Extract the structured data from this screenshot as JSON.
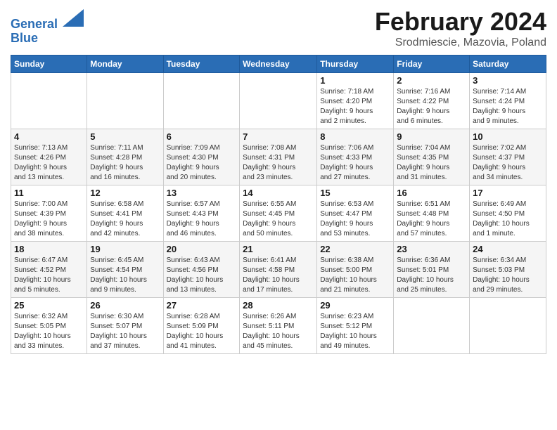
{
  "header": {
    "logo_line1": "General",
    "logo_line2": "Blue",
    "title": "February 2024",
    "subtitle": "Srodmiescie, Mazovia, Poland"
  },
  "days_of_week": [
    "Sunday",
    "Monday",
    "Tuesday",
    "Wednesday",
    "Thursday",
    "Friday",
    "Saturday"
  ],
  "weeks": [
    [
      {
        "day": "",
        "info": ""
      },
      {
        "day": "",
        "info": ""
      },
      {
        "day": "",
        "info": ""
      },
      {
        "day": "",
        "info": ""
      },
      {
        "day": "1",
        "info": "Sunrise: 7:18 AM\nSunset: 4:20 PM\nDaylight: 9 hours\nand 2 minutes."
      },
      {
        "day": "2",
        "info": "Sunrise: 7:16 AM\nSunset: 4:22 PM\nDaylight: 9 hours\nand 6 minutes."
      },
      {
        "day": "3",
        "info": "Sunrise: 7:14 AM\nSunset: 4:24 PM\nDaylight: 9 hours\nand 9 minutes."
      }
    ],
    [
      {
        "day": "4",
        "info": "Sunrise: 7:13 AM\nSunset: 4:26 PM\nDaylight: 9 hours\nand 13 minutes."
      },
      {
        "day": "5",
        "info": "Sunrise: 7:11 AM\nSunset: 4:28 PM\nDaylight: 9 hours\nand 16 minutes."
      },
      {
        "day": "6",
        "info": "Sunrise: 7:09 AM\nSunset: 4:30 PM\nDaylight: 9 hours\nand 20 minutes."
      },
      {
        "day": "7",
        "info": "Sunrise: 7:08 AM\nSunset: 4:31 PM\nDaylight: 9 hours\nand 23 minutes."
      },
      {
        "day": "8",
        "info": "Sunrise: 7:06 AM\nSunset: 4:33 PM\nDaylight: 9 hours\nand 27 minutes."
      },
      {
        "day": "9",
        "info": "Sunrise: 7:04 AM\nSunset: 4:35 PM\nDaylight: 9 hours\nand 31 minutes."
      },
      {
        "day": "10",
        "info": "Sunrise: 7:02 AM\nSunset: 4:37 PM\nDaylight: 9 hours\nand 34 minutes."
      }
    ],
    [
      {
        "day": "11",
        "info": "Sunrise: 7:00 AM\nSunset: 4:39 PM\nDaylight: 9 hours\nand 38 minutes."
      },
      {
        "day": "12",
        "info": "Sunrise: 6:58 AM\nSunset: 4:41 PM\nDaylight: 9 hours\nand 42 minutes."
      },
      {
        "day": "13",
        "info": "Sunrise: 6:57 AM\nSunset: 4:43 PM\nDaylight: 9 hours\nand 46 minutes."
      },
      {
        "day": "14",
        "info": "Sunrise: 6:55 AM\nSunset: 4:45 PM\nDaylight: 9 hours\nand 50 minutes."
      },
      {
        "day": "15",
        "info": "Sunrise: 6:53 AM\nSunset: 4:47 PM\nDaylight: 9 hours\nand 53 minutes."
      },
      {
        "day": "16",
        "info": "Sunrise: 6:51 AM\nSunset: 4:48 PM\nDaylight: 9 hours\nand 57 minutes."
      },
      {
        "day": "17",
        "info": "Sunrise: 6:49 AM\nSunset: 4:50 PM\nDaylight: 10 hours\nand 1 minute."
      }
    ],
    [
      {
        "day": "18",
        "info": "Sunrise: 6:47 AM\nSunset: 4:52 PM\nDaylight: 10 hours\nand 5 minutes."
      },
      {
        "day": "19",
        "info": "Sunrise: 6:45 AM\nSunset: 4:54 PM\nDaylight: 10 hours\nand 9 minutes."
      },
      {
        "day": "20",
        "info": "Sunrise: 6:43 AM\nSunset: 4:56 PM\nDaylight: 10 hours\nand 13 minutes."
      },
      {
        "day": "21",
        "info": "Sunrise: 6:41 AM\nSunset: 4:58 PM\nDaylight: 10 hours\nand 17 minutes."
      },
      {
        "day": "22",
        "info": "Sunrise: 6:38 AM\nSunset: 5:00 PM\nDaylight: 10 hours\nand 21 minutes."
      },
      {
        "day": "23",
        "info": "Sunrise: 6:36 AM\nSunset: 5:01 PM\nDaylight: 10 hours\nand 25 minutes."
      },
      {
        "day": "24",
        "info": "Sunrise: 6:34 AM\nSunset: 5:03 PM\nDaylight: 10 hours\nand 29 minutes."
      }
    ],
    [
      {
        "day": "25",
        "info": "Sunrise: 6:32 AM\nSunset: 5:05 PM\nDaylight: 10 hours\nand 33 minutes."
      },
      {
        "day": "26",
        "info": "Sunrise: 6:30 AM\nSunset: 5:07 PM\nDaylight: 10 hours\nand 37 minutes."
      },
      {
        "day": "27",
        "info": "Sunrise: 6:28 AM\nSunset: 5:09 PM\nDaylight: 10 hours\nand 41 minutes."
      },
      {
        "day": "28",
        "info": "Sunrise: 6:26 AM\nSunset: 5:11 PM\nDaylight: 10 hours\nand 45 minutes."
      },
      {
        "day": "29",
        "info": "Sunrise: 6:23 AM\nSunset: 5:12 PM\nDaylight: 10 hours\nand 49 minutes."
      },
      {
        "day": "",
        "info": ""
      },
      {
        "day": "",
        "info": ""
      }
    ]
  ]
}
